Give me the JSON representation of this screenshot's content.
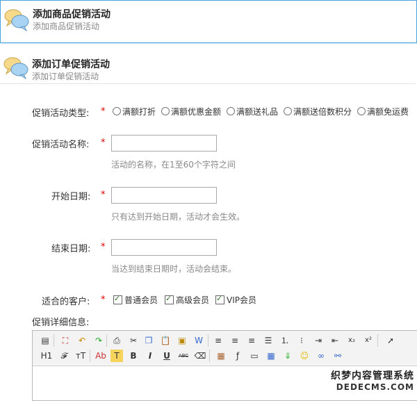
{
  "panel_goods": {
    "title": "添加商品促销活动",
    "subtitle": "添加商品促销活动"
  },
  "panel_order": {
    "title": "添加订单促销活动",
    "subtitle": "添加订单促销活动"
  },
  "form": {
    "required_mark": "*",
    "type_label": "促销活动类型:",
    "type_options": [
      "满额打折",
      "满额优惠金额",
      "满额送礼品",
      "满额送倍数积分",
      "满额免运费"
    ],
    "name_label": "促销活动名称:",
    "name_value": "",
    "name_hint": "活动的名称，在1至60个字符之间",
    "start_label": "开始日期:",
    "start_value": "",
    "start_hint": "只有达到开始日期，活动才会生效。",
    "end_label": "结束日期:",
    "end_value": "",
    "end_hint": "当达到结束日期时，活动会结束。",
    "customer_label": "适合的客户:",
    "customer_options": [
      "普通会员",
      "高级会员",
      "VIP会员"
    ],
    "detail_label": "促销详细信息:"
  },
  "editor": {
    "row2_labels": {
      "heading": "H1",
      "font": "𝓕",
      "size": "тT",
      "color": "Ab",
      "highlight": "T",
      "bold": "B",
      "italic": "I",
      "underline": "U",
      "strike": "ABC"
    }
  },
  "watermark": {
    "line1": "织梦内容管理系统",
    "line2": "DEDECMS.COM"
  }
}
